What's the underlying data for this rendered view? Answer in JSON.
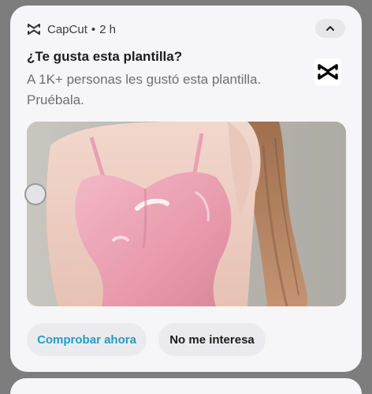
{
  "notification": {
    "app_name": "CapCut",
    "separator": "•",
    "time": "2 h",
    "title": "¿Te gusta esta plantilla?",
    "body": "A 1K+ personas les gustó esta plantilla. Pruébala.",
    "app_icon": "capcut-logo-icon",
    "expand_icon": "chevron-up-icon",
    "image_description_icon": "template-preview-image"
  },
  "actions": {
    "primary_label": "Comprobar ahora",
    "secondary_label": "No me interesa"
  },
  "colors": {
    "card_background": "#f6f6f8",
    "primary_action": "#1f9fc7",
    "button_background": "#ebebef",
    "backdrop": "#7d7d7d"
  }
}
